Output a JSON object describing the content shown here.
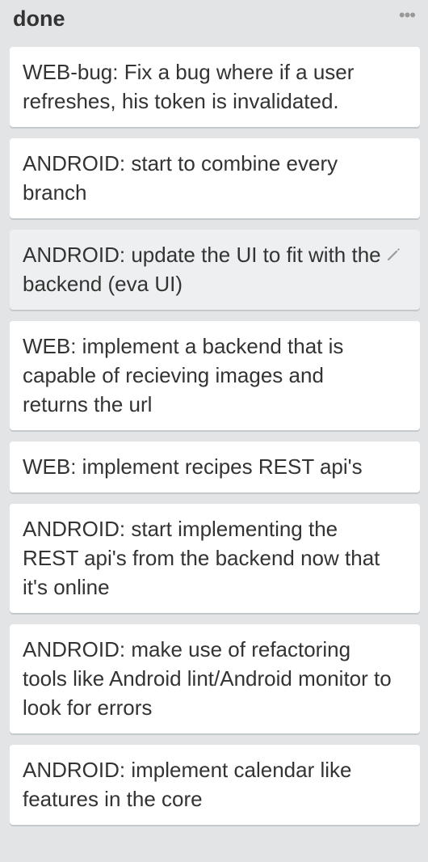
{
  "list": {
    "title": "done",
    "menu_icon": "ellipsis-icon",
    "cards": [
      {
        "title": "WEB-bug: Fix a bug where if a user refreshes, his token is invalidated."
      },
      {
        "title": "ANDROID: start to combine every branch"
      },
      {
        "title": "ANDROID: update the UI to fit with the backend (eva UI)",
        "hovered": true,
        "icon": "pencil-icon"
      },
      {
        "title": "WEB: implement a backend that is capable of recieving images and returns the url"
      },
      {
        "title": "WEB: implement recipes REST api's"
      },
      {
        "title": "ANDROID: start implementing the REST api's from the backend now that it's online"
      },
      {
        "title": "ANDROID: make use of refactoring tools like Android lint/Android monitor to look for errors"
      },
      {
        "title": "ANDROID: implement calendar like features in the core"
      }
    ]
  }
}
